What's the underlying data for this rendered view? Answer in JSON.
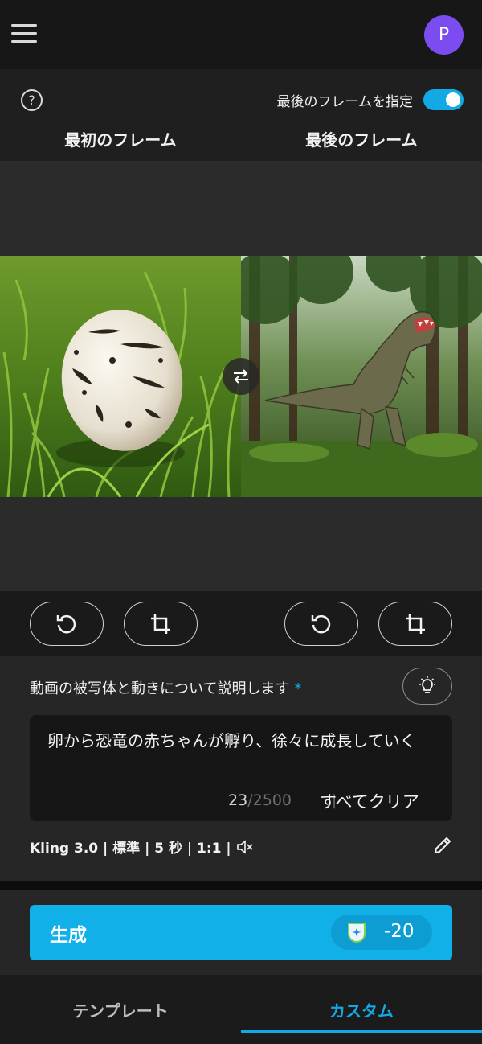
{
  "header": {
    "avatar_initial": "P",
    "menu_icon": "hamburger-icon"
  },
  "frames": {
    "help_icon": "question-circle-icon",
    "toggle_label": "最後のフレームを指定",
    "toggle_on": true,
    "first_title": "最初のフレーム",
    "last_title": "最後のフレーム",
    "swap_icon": "swap-arrows-icon"
  },
  "tools": {
    "first_rotate_icon": "rotate-ccw-icon",
    "first_crop_icon": "crop-icon",
    "last_rotate_icon": "rotate-ccw-icon",
    "last_crop_icon": "crop-icon"
  },
  "prompt": {
    "label": "動画の被写体と動きについて説明します",
    "required_mark": "*",
    "idea_icon": "lightbulb-icon",
    "text": "卵から恐竜の赤ちゃんが孵り、徐々に成長していく",
    "count": "23",
    "max": "/2500",
    "separator": "|",
    "clear_label": "すべてクリア"
  },
  "settings": {
    "summary": "Kling 3.0 | 標準 | 5 秒 | 1:1 |",
    "mute_icon": "speaker-muted-icon",
    "edit_icon": "pencil-icon"
  },
  "generate": {
    "label": "生成",
    "cost": "-20",
    "cost_icon": "credit-shield-icon"
  },
  "nav": {
    "template_label": "テンプレート",
    "custom_label": "カスタム",
    "active": "custom"
  },
  "colors": {
    "accent": "#12a9e4",
    "avatar": "#7b4df0",
    "generate_button": "#12b0e8"
  }
}
